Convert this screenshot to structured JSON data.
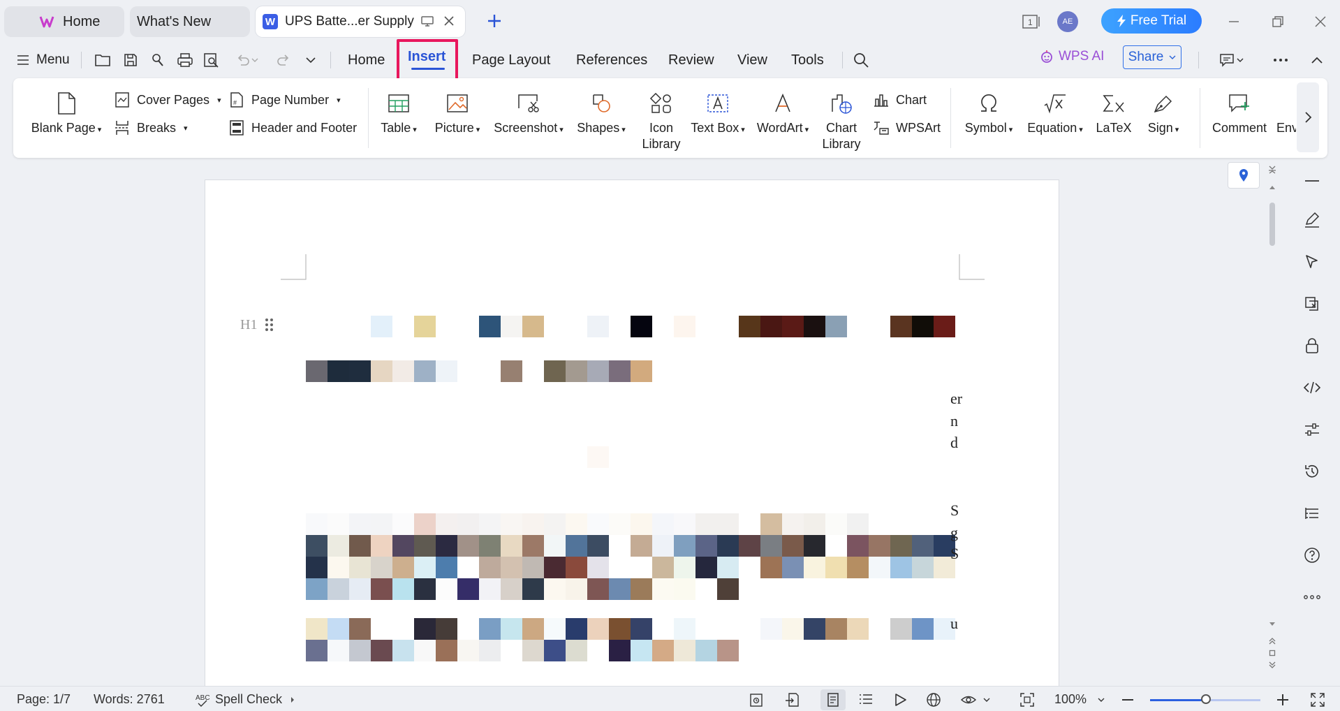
{
  "tabs": {
    "home": "Home",
    "whats_new": "What's New",
    "doc": "UPS Batte...er Supply"
  },
  "titlebar": {
    "avatar_initials": "AE",
    "free_trial": "Free Trial",
    "page_indicator": "1"
  },
  "menu": {
    "menu_label": "Menu",
    "tabs": [
      "Home",
      "Insert",
      "Page Layout",
      "References",
      "Review",
      "View",
      "Tools"
    ],
    "wps_ai": "WPS AI",
    "share": "Share"
  },
  "ribbon": {
    "blank_page": "Blank Page",
    "cover_pages": "Cover Pages",
    "breaks": "Breaks",
    "page_number": "Page Number",
    "header_footer": "Header and Footer",
    "table": "Table",
    "picture": "Picture",
    "screenshot": "Screenshot",
    "shapes": "Shapes",
    "icon_library_1": "Icon",
    "icon_library_2": "Library",
    "text_box": "Text Box",
    "wordart": "WordArt",
    "chart_library_1": "Chart",
    "chart_library_2": "Library",
    "chart": "Chart",
    "wpsart": "WPSArt",
    "symbol": "Symbol",
    "equation": "Equation",
    "latex": "LaTeX",
    "sign": "Sign",
    "comment": "Comment",
    "envelope_partial": "Env"
  },
  "document": {
    "heading_marker": "H1",
    "visible_chars": [
      "er",
      "n",
      "d",
      "S",
      "g",
      "S",
      "u"
    ]
  },
  "statusbar": {
    "page": "Page: 1/7",
    "words": "Words: 2761",
    "spell_check": "Spell Check",
    "zoom": "100%"
  },
  "colors": {
    "accent": "#2a54d6",
    "highlight_box": "#e8175d",
    "free_trial": "#2b7cff",
    "wps_ai": "#9a4fd6"
  }
}
